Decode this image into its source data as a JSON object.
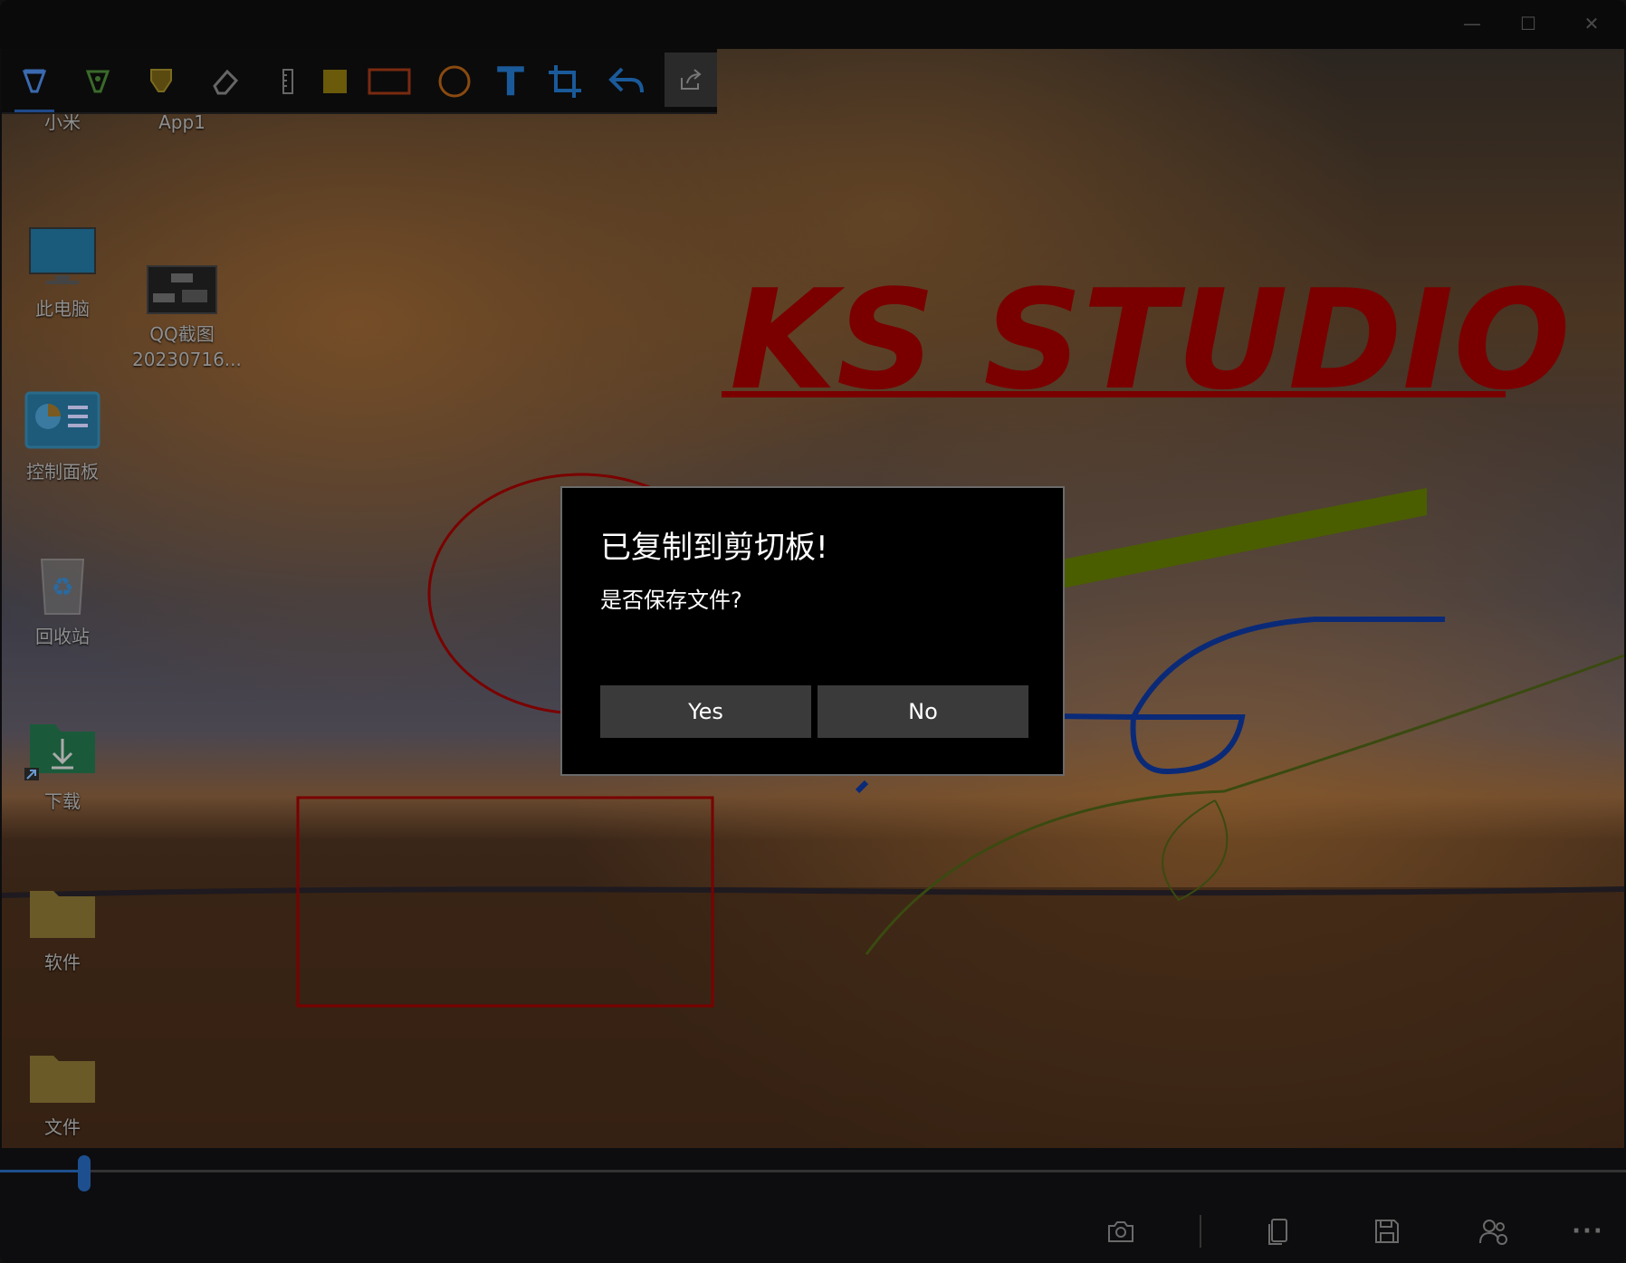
{
  "dialog": {
    "title": "已复制到剪切板!",
    "message": "是否保存文件?",
    "yes_label": "Yes",
    "no_label": "No"
  },
  "desktop_icons": [
    {
      "label": "小米",
      "icon": "folder-icon"
    },
    {
      "label": "App1",
      "icon": "folder-icon"
    },
    {
      "label": "此电脑",
      "icon": "monitor-icon"
    },
    {
      "label": "QQ截图\n20230716...",
      "icon": "screenshot-thumbnail-icon"
    },
    {
      "label": "控制面板",
      "icon": "control-panel-icon"
    },
    {
      "label": "回收站",
      "icon": "recycle-bin-icon"
    },
    {
      "label": "下载",
      "icon": "download-folder-icon"
    },
    {
      "label": "软件",
      "icon": "folder-icon"
    },
    {
      "label": "文件",
      "icon": "folder-icon"
    }
  ],
  "annotation": {
    "text": "KS STUDIO"
  },
  "toolbar": {
    "tools": [
      "pen-tool",
      "marker-tool",
      "highlighter-tool",
      "eraser-tool",
      "ruler-tool",
      "fill-color-tool",
      "rectangle-tool",
      "ellipse-tool",
      "text-tool",
      "crop-tool",
      "undo-tool",
      "share-tool"
    ],
    "text_tool_glyph": "T"
  },
  "bottombar": {
    "zoom_fraction": 0.05,
    "buttons": [
      "camera-icon",
      "copy-icon",
      "save-icon",
      "share-people-icon",
      "more-icon"
    ],
    "more_glyph": "···"
  },
  "colors": {
    "annotation_red": "#7a0000",
    "annotation_green": "#4a5e00",
    "annotation_blue": "#0a2a78",
    "accent_blue": "#1d4f8f"
  }
}
